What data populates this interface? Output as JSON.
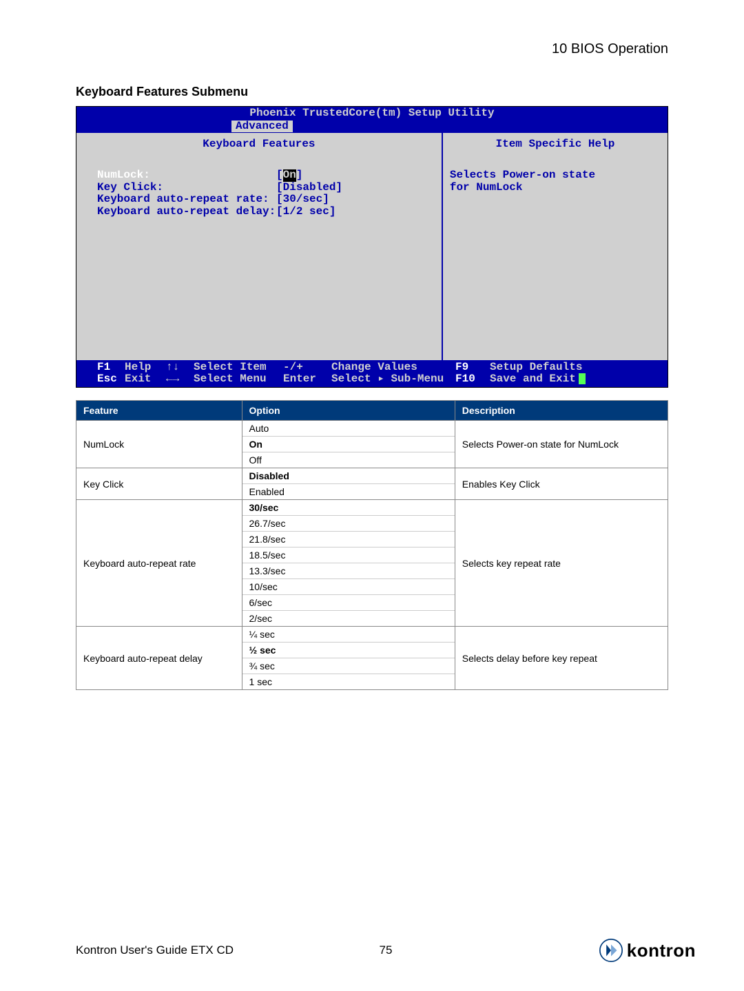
{
  "chapter": "10 BIOS Operation",
  "section_title": "Keyboard Features Submenu",
  "bios": {
    "title": "Phoenix TrustedCore(tm) Setup Utility",
    "active_menu": "Advanced",
    "left_title": "Keyboard Features",
    "right_title": "Item Specific Help",
    "items": [
      {
        "label": "NumLock:",
        "value": "On",
        "hl": true
      },
      {
        "label": "Key Click:",
        "value": "Disabled",
        "hl": false
      },
      {
        "label": "Keyboard auto-repeat rate:",
        "value": "30/sec",
        "hl": false
      },
      {
        "label": "Keyboard auto-repeat delay:",
        "value": "1/2 sec",
        "hl": false
      }
    ],
    "help_line1": "Selects Power-on state",
    "help_line2": "for NumLock",
    "footer": {
      "r1": [
        "F1",
        "Help",
        "↑↓",
        "Select Item",
        "-/+",
        "Change Values",
        "F9",
        "Setup Defaults"
      ],
      "r2": [
        "Esc",
        "Exit",
        "←→",
        "Select Menu",
        "Enter",
        "Select ▸ Sub-Menu",
        "F10",
        "Save and Exit"
      ]
    }
  },
  "table": {
    "headers": [
      "Feature",
      "Option",
      "Description"
    ],
    "rows": [
      {
        "feature": "NumLock",
        "options": [
          {
            "t": "Auto"
          },
          {
            "t": "On",
            "b": true
          },
          {
            "t": "Off"
          }
        ],
        "desc": "Selects Power-on state for NumLock"
      },
      {
        "feature": "Key Click",
        "options": [
          {
            "t": "Disabled",
            "b": true
          },
          {
            "t": "Enabled"
          }
        ],
        "desc": "Enables Key Click"
      },
      {
        "feature": "Keyboard auto-repeat rate",
        "options": [
          {
            "t": "30/sec",
            "b": true
          },
          {
            "t": "26.7/sec"
          },
          {
            "t": "21.8/sec"
          },
          {
            "t": "18.5/sec"
          },
          {
            "t": "13.3/sec"
          },
          {
            "t": "10/sec"
          },
          {
            "t": "6/sec"
          },
          {
            "t": "2/sec"
          }
        ],
        "desc": "Selects key repeat rate"
      },
      {
        "feature": "Keyboard auto-repeat delay",
        "options": [
          {
            "t": "¼ sec"
          },
          {
            "t": "½ sec",
            "b": true
          },
          {
            "t": "¾ sec"
          },
          {
            "t": "1 sec"
          }
        ],
        "desc": "Selects delay before key repeat"
      }
    ]
  },
  "footer": {
    "guide": "Kontron User's Guide ETX CD",
    "page": "75",
    "brand": "kontron"
  }
}
